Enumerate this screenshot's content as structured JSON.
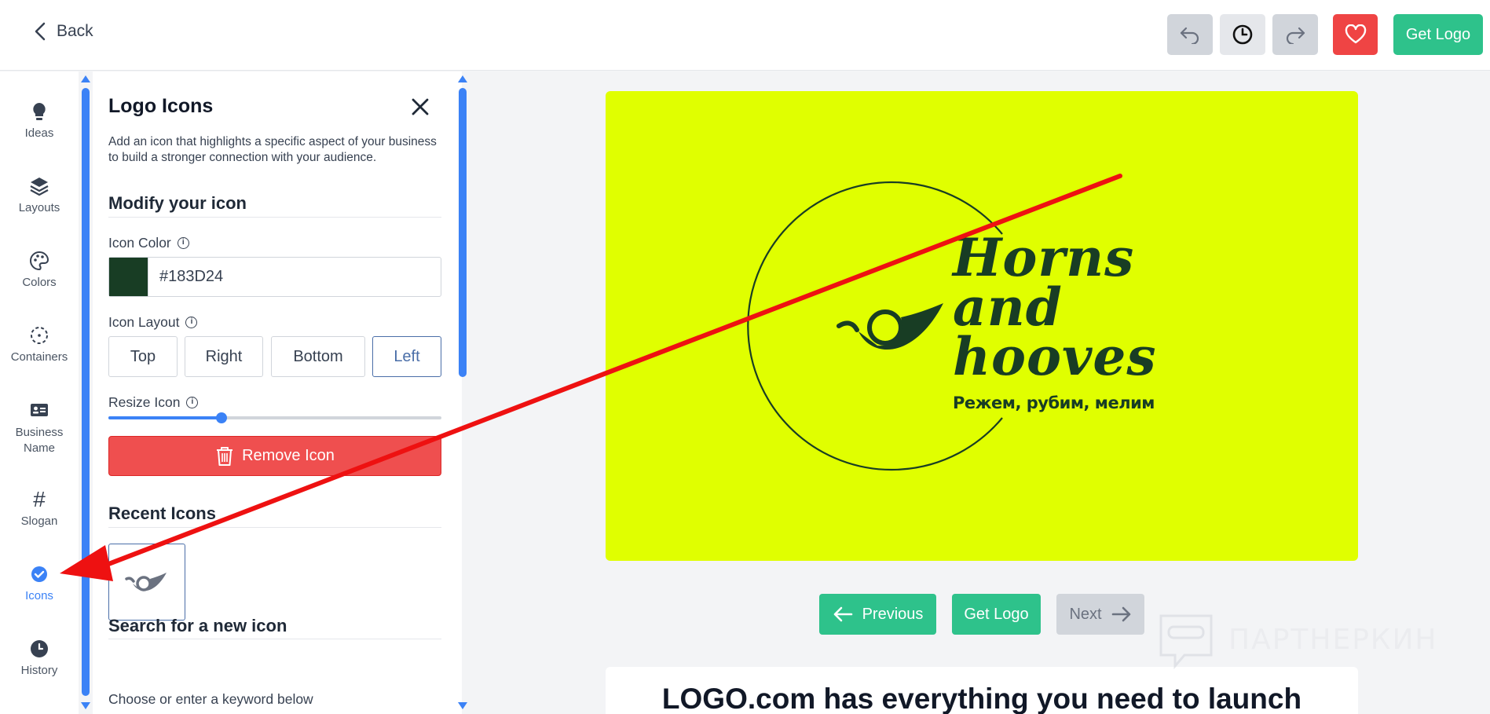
{
  "header": {
    "back_label": "Back",
    "get_logo_label": "Get Logo"
  },
  "rail": {
    "items": [
      {
        "label": "Ideas",
        "icon": "lightbulb-icon"
      },
      {
        "label": "Layouts",
        "icon": "layers-icon"
      },
      {
        "label": "Colors",
        "icon": "palette-icon"
      },
      {
        "label": "Containers",
        "icon": "container-icon"
      },
      {
        "label": "Business Name",
        "icon": "id-card-icon"
      },
      {
        "label": "Slogan",
        "icon": "hashtag-icon"
      },
      {
        "label": "Icons",
        "icon": "verified-badge-icon"
      },
      {
        "label": "History",
        "icon": "clock-icon"
      }
    ],
    "active": "Icons"
  },
  "panel": {
    "title": "Logo Icons",
    "description": "Add an icon that highlights a specific aspect of your business to build a stronger connection with your audience.",
    "modify_heading": "Modify your icon",
    "icon_color_label": "Icon Color",
    "icon_color_value": "#183D24",
    "icon_layout_label": "Icon Layout",
    "layout_options": [
      "Top",
      "Right",
      "Bottom",
      "Left"
    ],
    "layout_selected": "Left",
    "resize_label": "Resize Icon",
    "resize_value": 0.34,
    "remove_label": "Remove Icon",
    "recent_heading": "Recent Icons",
    "search_heading": "Search for a new icon",
    "search_hint": "Choose or enter a keyword below"
  },
  "preview": {
    "brand_line1": "Horns",
    "brand_line2": "and",
    "brand_line3": "hooves",
    "tagline": "Режем, рубим, мелим",
    "background_color": "#e0ff00",
    "text_color": "#183D24"
  },
  "nav": {
    "previous_label": "Previous",
    "get_logo_label": "Get Logo",
    "next_label": "Next"
  },
  "promo": {
    "text": "LOGO.com has everything you need to launch"
  },
  "watermark": {
    "text": "ПАРТНЕРКИН"
  },
  "colors": {
    "accent_green": "#2ec28b",
    "accent_blue": "#3b82f6",
    "danger_red": "#ef4444",
    "annotation_red": "#ee1111"
  }
}
